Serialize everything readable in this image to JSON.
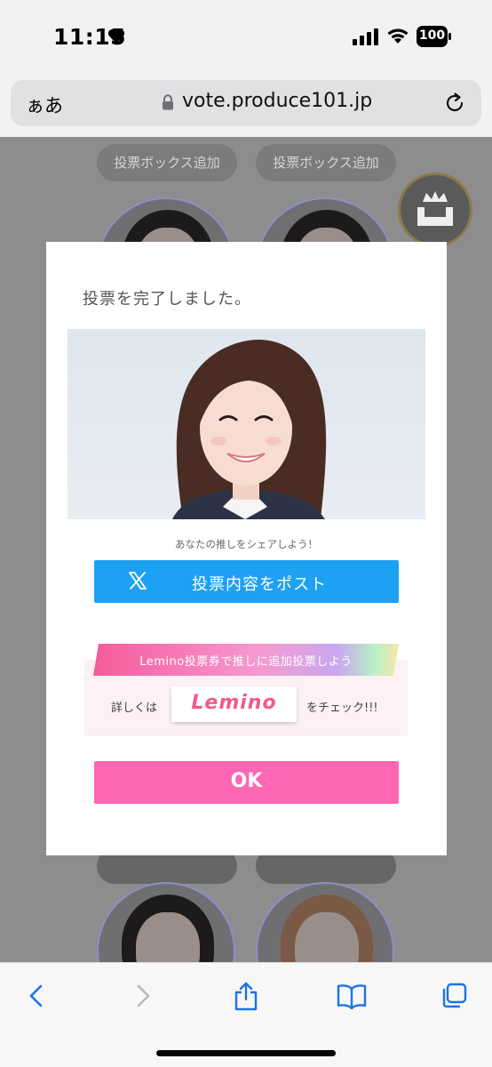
{
  "status_bar": {
    "time": "11:15",
    "battery": "100"
  },
  "browser": {
    "aa_label": "ぁあ",
    "url": "vote.produce101.jp"
  },
  "page": {
    "add_box_buttons": [
      "投票ボックス追加",
      "投票ボックス追加"
    ]
  },
  "modal": {
    "title": "投票を完了しました。",
    "share_prompt": "あなたの推しをシェアしよう！",
    "post_button": "投票内容をポスト",
    "lemino_banner": "Lemino投票券で推しに追加投票しよう",
    "details_prefix": "詳しくは",
    "lemino_logo": "Lemino",
    "details_suffix": "をチェック!!!",
    "ok_button": "OK"
  },
  "colors": {
    "x_blue": "#1da1f2",
    "ok_pink": "#ff66b3",
    "lemino_pink": "#f05a8c"
  }
}
